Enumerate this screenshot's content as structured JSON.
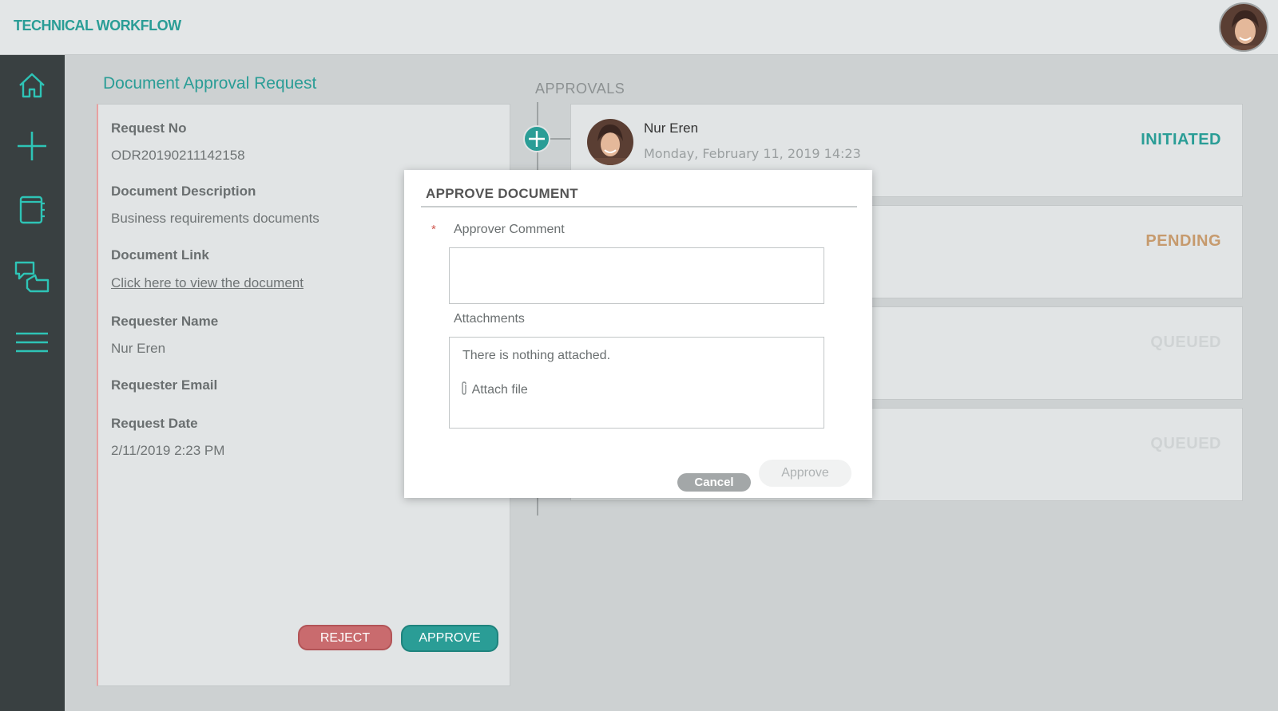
{
  "header": {
    "app_title": "TECHNICAL WORKFLOW"
  },
  "sidebar": {
    "items": [
      {
        "icon": "home-icon"
      },
      {
        "icon": "plus-icon"
      },
      {
        "icon": "notebook-icon"
      },
      {
        "icon": "approvals-icon"
      },
      {
        "icon": "menu-icon"
      }
    ]
  },
  "request": {
    "page_title": "Document Approval Request",
    "fields": {
      "request_no_label": "Request No",
      "request_no_value": "ODR20190211142158",
      "description_label": "Document Description",
      "description_value": "Business requirements documents",
      "link_label": "Document Link",
      "link_text": "Click here to view the document",
      "requester_name_label": "Requester Name",
      "requester_name_value": "Nur Eren",
      "requester_email_label": "Requester Email",
      "request_date_label": "Request Date",
      "request_date_value": "2/11/2019 2:23 PM"
    },
    "reject_label": "REJECT",
    "approve_label": "APPROVE"
  },
  "approvals": {
    "heading": "APPROVALS",
    "items": [
      {
        "name": "Nur Eren",
        "date": "Monday, February 11, 2019 14:23",
        "status": "INITIATED",
        "status_color": "#2a9d96"
      },
      {
        "name": "",
        "date": "",
        "status": "PENDING",
        "status_color": "#c69a6d"
      },
      {
        "name": "",
        "date": "",
        "status": "QUEUED",
        "status_color": "#cfd3d4"
      },
      {
        "name": "",
        "date": "",
        "status": "QUEUED",
        "status_color": "#cfd3d4"
      }
    ]
  },
  "modal": {
    "title": "APPROVE DOCUMENT",
    "comment_label": "Approver Comment",
    "required_marker": "*",
    "attachments_label": "Attachments",
    "attachments_empty": "There is nothing attached.",
    "attach_file_label": "Attach file",
    "cancel_label": "Cancel",
    "approve_label": "Approve"
  }
}
